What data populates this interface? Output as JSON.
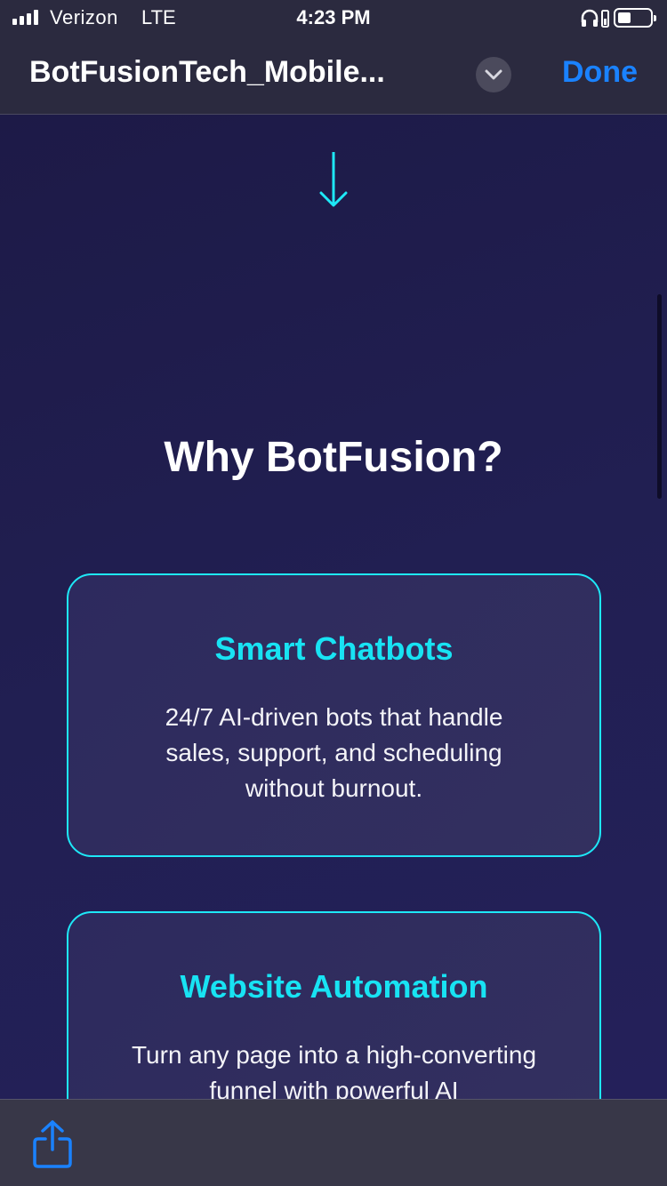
{
  "status_bar": {
    "carrier": "Verizon",
    "network": "LTE",
    "time": "4:23 PM"
  },
  "nav": {
    "title": "BotFusionTech_Mobile...",
    "done_label": "Done",
    "chevron_icon": "chevron-down-icon"
  },
  "content": {
    "section_title": "Why BotFusion?",
    "cards": [
      {
        "title": "Smart Chatbots",
        "text": "24/7 AI-driven bots that handle sales, support, and scheduling without burnout."
      },
      {
        "title": "Website Automation",
        "text": "Turn any page into a high-converting funnel with powerful AI"
      }
    ]
  },
  "toolbar": {
    "share_icon": "share-icon"
  },
  "colors": {
    "accent_cyan": "#1ee8f7",
    "link_blue": "#1a82ff",
    "background": "#1f1b4a",
    "bar_background": "#2b2a3f"
  }
}
